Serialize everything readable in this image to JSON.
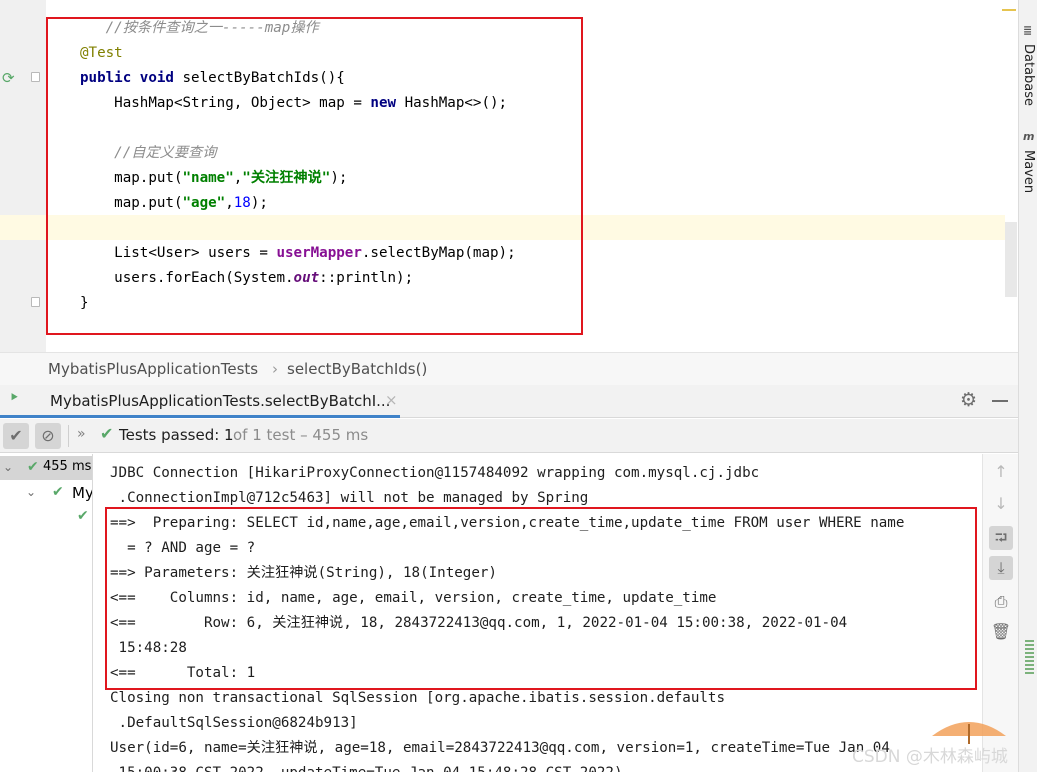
{
  "editor": {
    "code_lines": [
      {
        "parts": [
          {
            "t": "   ",
            "c": ""
          },
          {
            "t": "//按条件查询之一-----map操作",
            "c": "cm"
          }
        ]
      },
      {
        "parts": [
          {
            "t": "@Test",
            "c": "an"
          }
        ]
      },
      {
        "parts": [
          {
            "t": "public void ",
            "c": "kw"
          },
          {
            "t": "selectByBatchIds(){",
            "c": ""
          }
        ]
      },
      {
        "parts": [
          {
            "t": "    HashMap<String, Object> map = ",
            "c": ""
          },
          {
            "t": "new ",
            "c": "kw"
          },
          {
            "t": "HashMap<>();",
            "c": ""
          }
        ]
      },
      {
        "parts": [
          {
            "t": "",
            "c": ""
          }
        ]
      },
      {
        "parts": [
          {
            "t": "    ",
            "c": ""
          },
          {
            "t": "//自定义要查询",
            "c": "cm"
          }
        ]
      },
      {
        "parts": [
          {
            "t": "    map.put(",
            "c": ""
          },
          {
            "t": "\"name\"",
            "c": "st"
          },
          {
            "t": ",",
            "c": ""
          },
          {
            "t": "\"关注狂神说\"",
            "c": "st"
          },
          {
            "t": ");",
            "c": ""
          }
        ]
      },
      {
        "parts": [
          {
            "t": "    map.put(",
            "c": ""
          },
          {
            "t": "\"age\"",
            "c": "st"
          },
          {
            "t": ",",
            "c": ""
          },
          {
            "t": "18",
            "c": "nm"
          },
          {
            "t": ");",
            "c": ""
          }
        ]
      },
      {
        "parts": [
          {
            "t": "",
            "c": ""
          }
        ]
      },
      {
        "parts": [
          {
            "t": "    List<User> users = ",
            "c": ""
          },
          {
            "t": "userMapper",
            "c": "mbr"
          },
          {
            "t": ".selectByMap(map);",
            "c": ""
          }
        ]
      },
      {
        "parts": [
          {
            "t": "    users.forEach(System.",
            "c": ""
          },
          {
            "t": "out",
            "c": "fld"
          },
          {
            "t": "::println);",
            "c": ""
          }
        ]
      },
      {
        "parts": [
          {
            "t": "}",
            "c": ""
          }
        ]
      }
    ]
  },
  "breadcrumb": {
    "class_name": "MybatisPlusApplicationTests",
    "separator": "›",
    "method_name": "selectByBatchIds()"
  },
  "tool_stripe": {
    "database_label": "Database",
    "maven_label": "Maven"
  },
  "run_tab": {
    "label": "MybatisPlusApplicationTests.selectByBatchI...",
    "close": "×"
  },
  "test_toolbar": {
    "chevrons": "»",
    "status": "Tests passed: 1",
    "status_detail": "of 1 test – 455 ms"
  },
  "tree": {
    "root_time": "455 ms",
    "child_label": "My"
  },
  "console": {
    "lines": [
      "JDBC Connection [HikariProxyConnection@1157484092 wrapping com.mysql.cj.jdbc",
      " .ConnectionImpl@712c5463] will not be managed by Spring",
      "==>  Preparing: SELECT id,name,age,email,version,create_time,update_time FROM user WHERE name",
      "  = ? AND age = ?",
      "==> Parameters: 关注狂神说(String), 18(Integer)",
      "<==    Columns: id, name, age, email, version, create_time, update_time",
      "<==        Row: 6, 关注狂神说, 18, 2843722413@qq.com, 1, 2022-01-04 15:00:38, 2022-01-04",
      " 15:48:28",
      "<==      Total: 1",
      "Closing non transactional SqlSession [org.apache.ibatis.session.defaults",
      " .DefaultSqlSession@6824b913]",
      "User(id=6, name=关注狂神说, age=18, email=2843722413@qq.com, version=1, createTime=Tue Jan 04",
      " 15:00:38 CST 2022, updateTime=Tue Jan 04 15:48:28 CST 2022)"
    ]
  },
  "watermark": "CSDN @木林森屿城",
  "colors": {
    "highlight_box": "#e0161e",
    "pass_green": "#59a869",
    "tab_underline": "#4083c9"
  }
}
